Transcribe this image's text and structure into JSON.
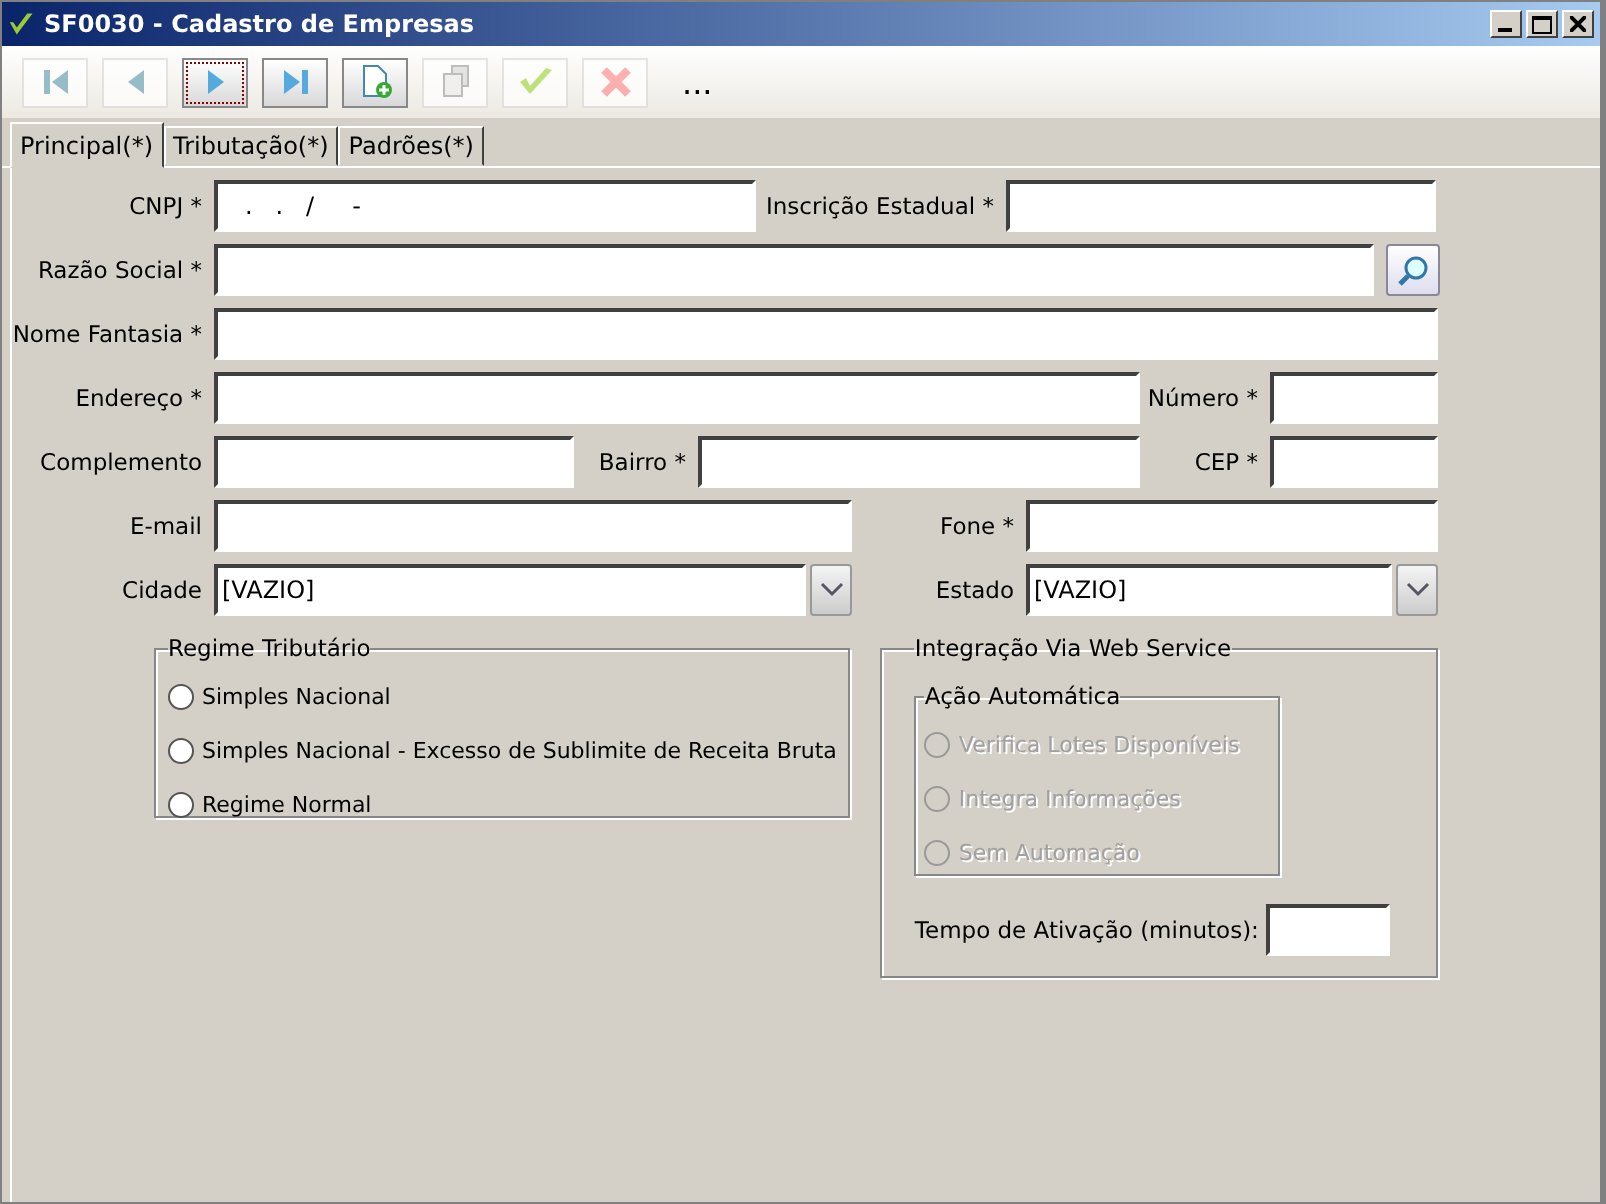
{
  "window": {
    "title": "SF0030 - Cadastro de Empresas"
  },
  "toolbar": [
    {
      "kind": "first",
      "disabled": true,
      "focused": false
    },
    {
      "kind": "prev",
      "disabled": true,
      "focused": false
    },
    {
      "kind": "next",
      "disabled": false,
      "focused": true
    },
    {
      "kind": "last",
      "disabled": false,
      "focused": false
    },
    {
      "kind": "new",
      "disabled": false,
      "focused": false
    },
    {
      "kind": "copy",
      "disabled": true,
      "focused": false
    },
    {
      "kind": "confirm",
      "disabled": true,
      "focused": false
    },
    {
      "kind": "cancel",
      "disabled": true,
      "focused": false
    },
    {
      "kind": "more",
      "label": "..."
    }
  ],
  "tabs": [
    {
      "label": "Principal(*)",
      "selected": true
    },
    {
      "label": "Tributação(*)",
      "selected": false
    },
    {
      "label": "Padrões(*)",
      "selected": false
    }
  ],
  "rows": [
    [
      {
        "label": "CNPJ *",
        "kind": "text",
        "value": "   .   .   /     -"
      },
      {
        "label": "Inscrição Estadual *",
        "kind": "text"
      }
    ],
    [
      {
        "label": "Razão Social *",
        "kind": "lookup"
      }
    ],
    [
      {
        "label": "Nome Fantasia *",
        "kind": "text"
      }
    ],
    [
      {
        "label": "Endereço *",
        "kind": "text"
      },
      {
        "label": "Número *",
        "kind": "text"
      }
    ],
    [
      {
        "label": "Complemento",
        "kind": "text"
      },
      {
        "label": "Bairro *",
        "kind": "text"
      },
      {
        "label": "CEP *",
        "kind": "text"
      }
    ],
    [
      {
        "label": "E-mail",
        "kind": "text"
      },
      {
        "label": "Fone *",
        "kind": "text"
      }
    ],
    [
      {
        "label": "Cidade",
        "kind": "combo",
        "value": "[VAZIO]"
      },
      {
        "label": "Estado",
        "kind": "combo",
        "value": "[VAZIO]"
      }
    ]
  ],
  "regime": {
    "title": "Regime Tributário",
    "options": [
      {
        "label": "Simples Nacional",
        "selected": false,
        "disabled": false
      },
      {
        "label": "Simples Nacional - Excesso de Sublimite de Receita Bruta",
        "selected": false,
        "disabled": false
      },
      {
        "label": "Regime Normal",
        "selected": false,
        "disabled": false
      }
    ]
  },
  "integracao": {
    "title": "Integração Via Web Service",
    "acao": {
      "title": "Ação Automática",
      "options": [
        {
          "label": "Verifica Lotes Disponíveis",
          "selected": false,
          "disabled": true
        },
        {
          "label": "Integra Informações",
          "selected": false,
          "disabled": true
        },
        {
          "label": "Sem Automação",
          "selected": false,
          "disabled": true
        }
      ]
    },
    "tempo": {
      "label": "Tempo de Ativação (minutos):"
    }
  }
}
